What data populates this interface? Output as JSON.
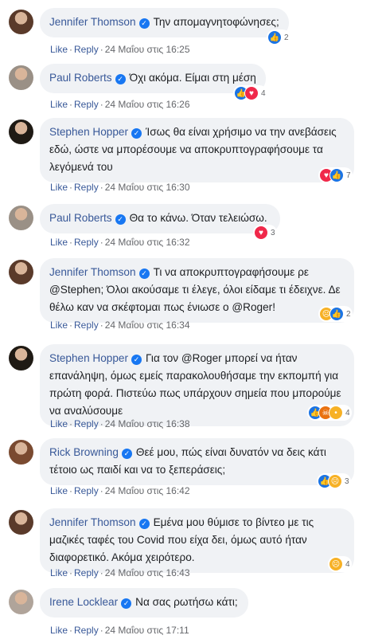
{
  "labels": {
    "like": "Like",
    "reply": "Reply",
    "dot": "·"
  },
  "comments": [
    {
      "author": "Jennifer Thomson",
      "text": "Την απομαγνητοφώνησες;",
      "reactions": [
        "like"
      ],
      "count": "2",
      "time": "24 Μαΐου στις 16:25",
      "avatar_color": "#5a3a2a"
    },
    {
      "author": "Paul Roberts",
      "text": "Όχι ακόμα. Είμαι στη μέση",
      "reactions": [
        "like",
        "love"
      ],
      "count": "4",
      "time": "24 Μαΐου στις 16:26",
      "avatar_color": "#9a9086"
    },
    {
      "author": "Stephen Hopper",
      "text": "Ίσως θα είναι χρήσιμο να την ανεβάσεις εδώ, ώστε να μπορέσουμε να αποκρυπτογραφήσουμε τα λεγόμενά του",
      "reactions": [
        "love",
        "like"
      ],
      "count": "7",
      "time": "24 Μαΐου στις 16:30",
      "avatar_color": "#1f1a14"
    },
    {
      "author": "Paul Roberts",
      "text": "Θα το κάνω. Όταν τελειώσω.",
      "reactions": [
        "love"
      ],
      "count": "3",
      "time": "24 Μαΐου στις 16:32",
      "avatar_color": "#9a9086"
    },
    {
      "author": "Jennifer Thomson",
      "text": "Τι να αποκρυπτογραφήσουμε ρε @Stephen; Όλοι ακούσαμε τι έλεγε, όλοι είδαμε τι έδειχνε. Δε θέλω καν να σκέφτομαι πως ένιωσε ο @Roger!",
      "reactions": [
        "sad",
        "like"
      ],
      "count": "2",
      "time": "24 Μαΐου στις 16:34",
      "avatar_color": "#5a3a2a"
    },
    {
      "author": "Stephen Hopper",
      "text": "Για τον @Roger μπορεί να ήταν επανάληψη, όμως εμείς παρακολουθήσαμε την εκπομπή για πρώτη φορά. Πιστεύω πως υπάρχουν σημεία που μπορούμε να αναλύσουμε",
      "reactions": [
        "like",
        "angry",
        "wow"
      ],
      "count": "4",
      "time": "24 Μαΐου στις 16:38",
      "avatar_color": "#1f1a14"
    },
    {
      "author": "Rick Browning",
      "text": "Θεέ μου, πώς είναι δυνατόν να δεις κάτι τέτοιο ως παιδί και να το ξεπεράσεις;",
      "reactions": [
        "like",
        "sad"
      ],
      "count": "3",
      "time": "24 Μαΐου στις 16:42",
      "avatar_color": "#7a4a30"
    },
    {
      "author": "Jennifer Thomson",
      "text": "Εμένα μου θύμισε το βίντεο με τις μαζικές ταφές του Covid που είχα δει, όμως αυτό ήταν διαφορετικό. Ακόμα χειρότερο.",
      "reactions": [
        "sad"
      ],
      "count": "4",
      "time": "24 Μαΐου στις 16:43",
      "avatar_color": "#5a3a2a"
    },
    {
      "author": "Irene Locklear",
      "text": "Να σας ρωτήσω κάτι;",
      "reactions": [],
      "count": "",
      "time": "24 Μαΐου στις 17:11",
      "avatar_color": "#b0a49a"
    }
  ]
}
